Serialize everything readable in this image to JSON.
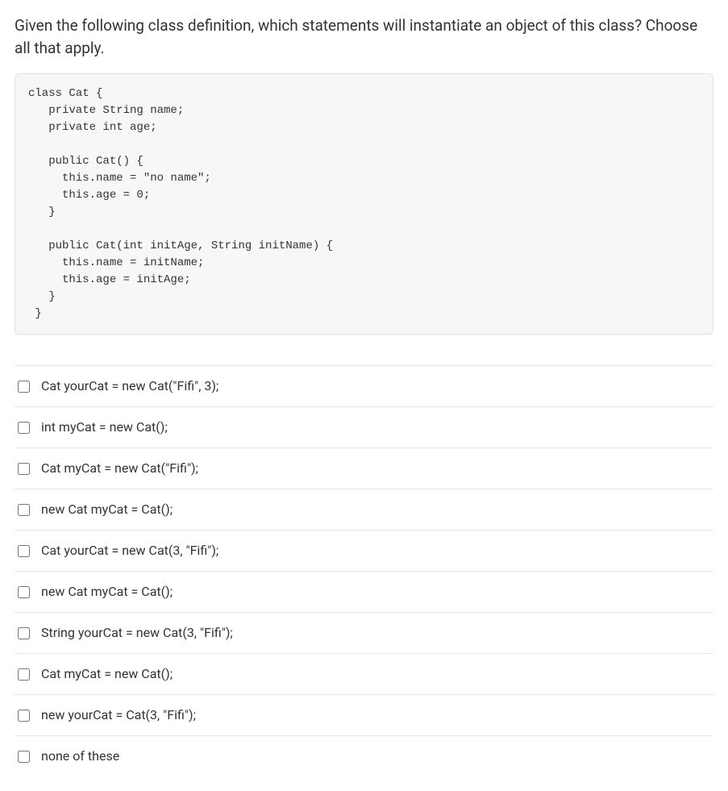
{
  "question": "Given the following class definition, which statements will instantiate an object of this class? Choose all that apply.",
  "code": "class Cat {\n   private String name;\n   private int age;\n\n   public Cat() {\n     this.name = \"no name\";\n     this.age = 0;\n   }\n\n   public Cat(int initAge, String initName) {\n     this.name = initName;\n     this.age = initAge;\n   }\n }",
  "options": [
    {
      "label": "Cat yourCat = new Cat(\"Fifi\", 3);"
    },
    {
      "label": "int myCat = new Cat();"
    },
    {
      "label": "Cat myCat = new Cat(\"Fifi\");"
    },
    {
      "label": "new Cat myCat = Cat();"
    },
    {
      "label": "Cat yourCat = new Cat(3, \"Fifi\");"
    },
    {
      "label": "new Cat myCat = Cat();"
    },
    {
      "label": "String yourCat = new Cat(3, \"Fifi\");"
    },
    {
      "label": "Cat myCat = new Cat();"
    },
    {
      "label": "new yourCat = Cat(3, \"Fifi\");"
    },
    {
      "label": "none of these"
    }
  ]
}
